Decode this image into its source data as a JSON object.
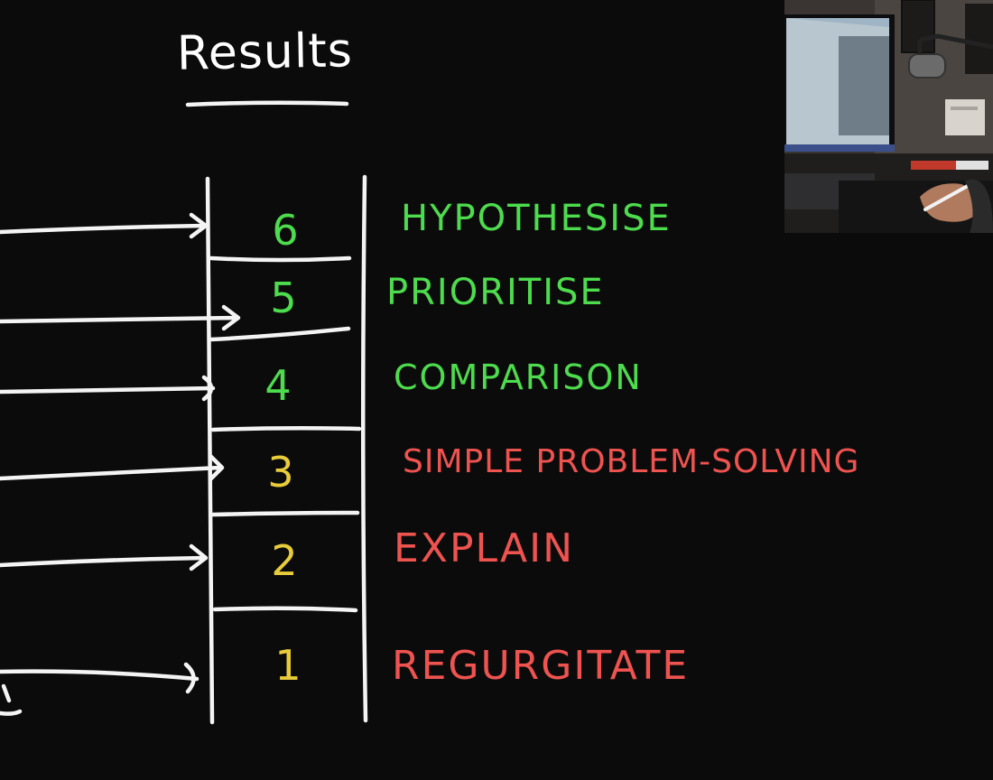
{
  "title": "Results",
  "colors": {
    "chalk": "#f4f4f4",
    "higher_order": "#4ddc4d",
    "lower_order_number": "#e8cc3a",
    "lower_order_label": "#ef5350"
  },
  "levels": [
    {
      "number": "6",
      "label": "HYPOTHESISE",
      "tier": "higher"
    },
    {
      "number": "5",
      "label": "PRIORITISE",
      "tier": "higher"
    },
    {
      "number": "4",
      "label": "COMPARISON",
      "tier": "higher"
    },
    {
      "number": "3",
      "label": "SIMPLE PROBLEM-SOLVING",
      "tier": "lower"
    },
    {
      "number": "2",
      "label": "EXPLAIN",
      "tier": "lower"
    },
    {
      "number": "1",
      "label": "REGURGITATE",
      "tier": "lower"
    }
  ],
  "webcam": {
    "content": "presenter-webcam-feed",
    "icons": [
      "monitor-icon",
      "microphone-icon",
      "stylus-icon"
    ]
  }
}
